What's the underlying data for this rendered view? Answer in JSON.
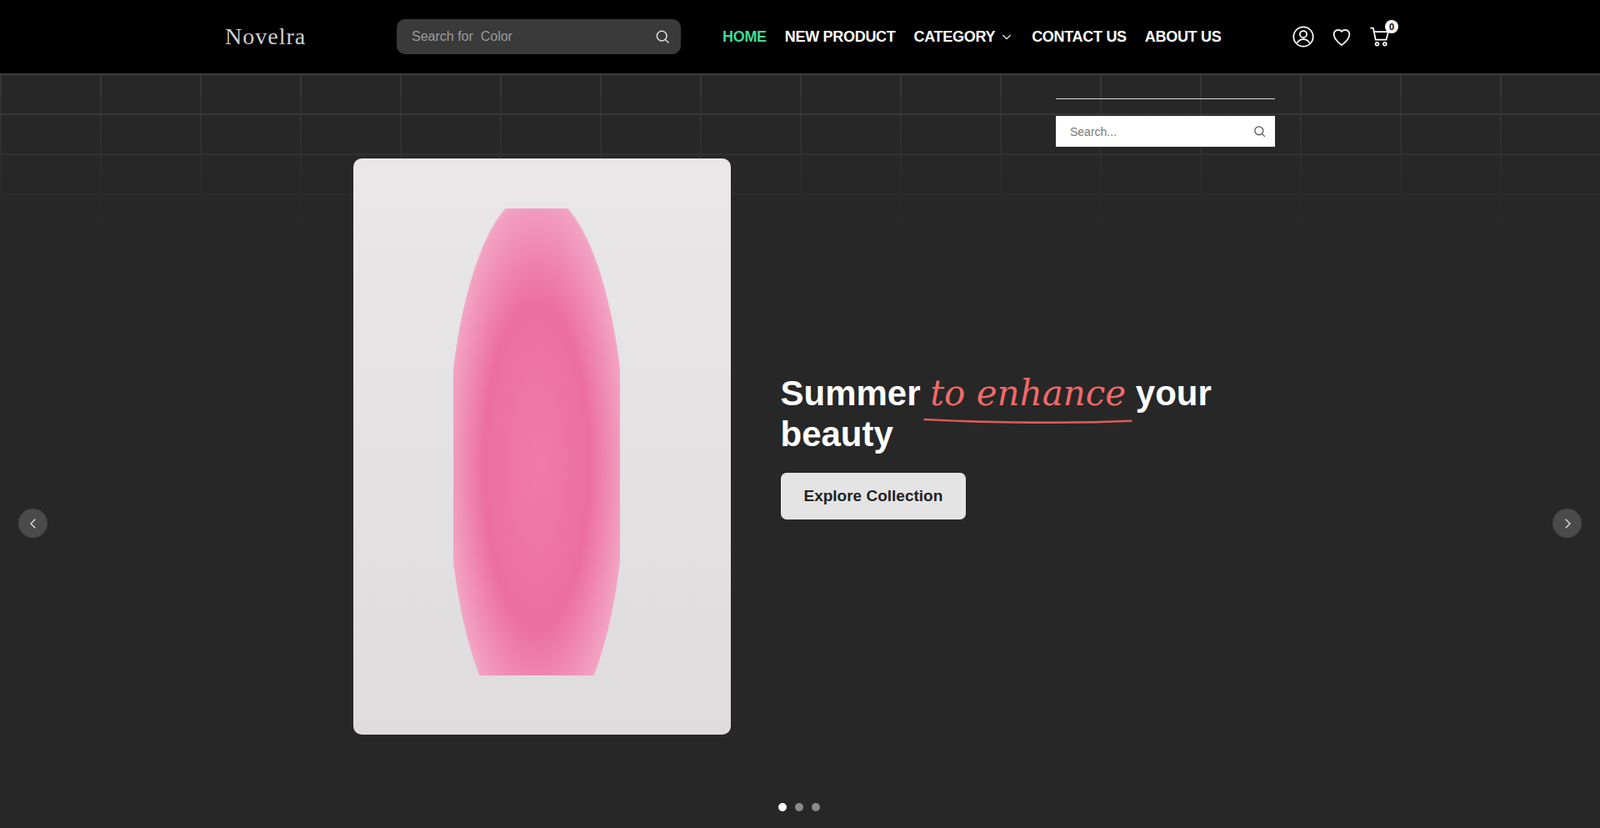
{
  "header": {
    "logo": "Novelra",
    "search": {
      "placeholder": "Search for  Color"
    },
    "nav": [
      {
        "label": "HOME",
        "selected": true,
        "dropdown": false
      },
      {
        "label": "NEW PRODUCT",
        "selected": false,
        "dropdown": false
      },
      {
        "label": "CATEGORY",
        "selected": false,
        "dropdown": true
      },
      {
        "label": "CONTACT US",
        "selected": false,
        "dropdown": false
      },
      {
        "label": "ABOUT US",
        "selected": false,
        "dropdown": false
      }
    ],
    "cart_count": "0"
  },
  "overlay_search": {
    "placeholder": "Search..."
  },
  "hero": {
    "title_before": "Summer ",
    "title_highlight": "to enhance",
    "title_after": " your beauty",
    "button": "Explore Collection"
  },
  "slides": [
    {
      "selected": true
    },
    {
      "selected": false
    },
    {
      "selected": false
    }
  ]
}
